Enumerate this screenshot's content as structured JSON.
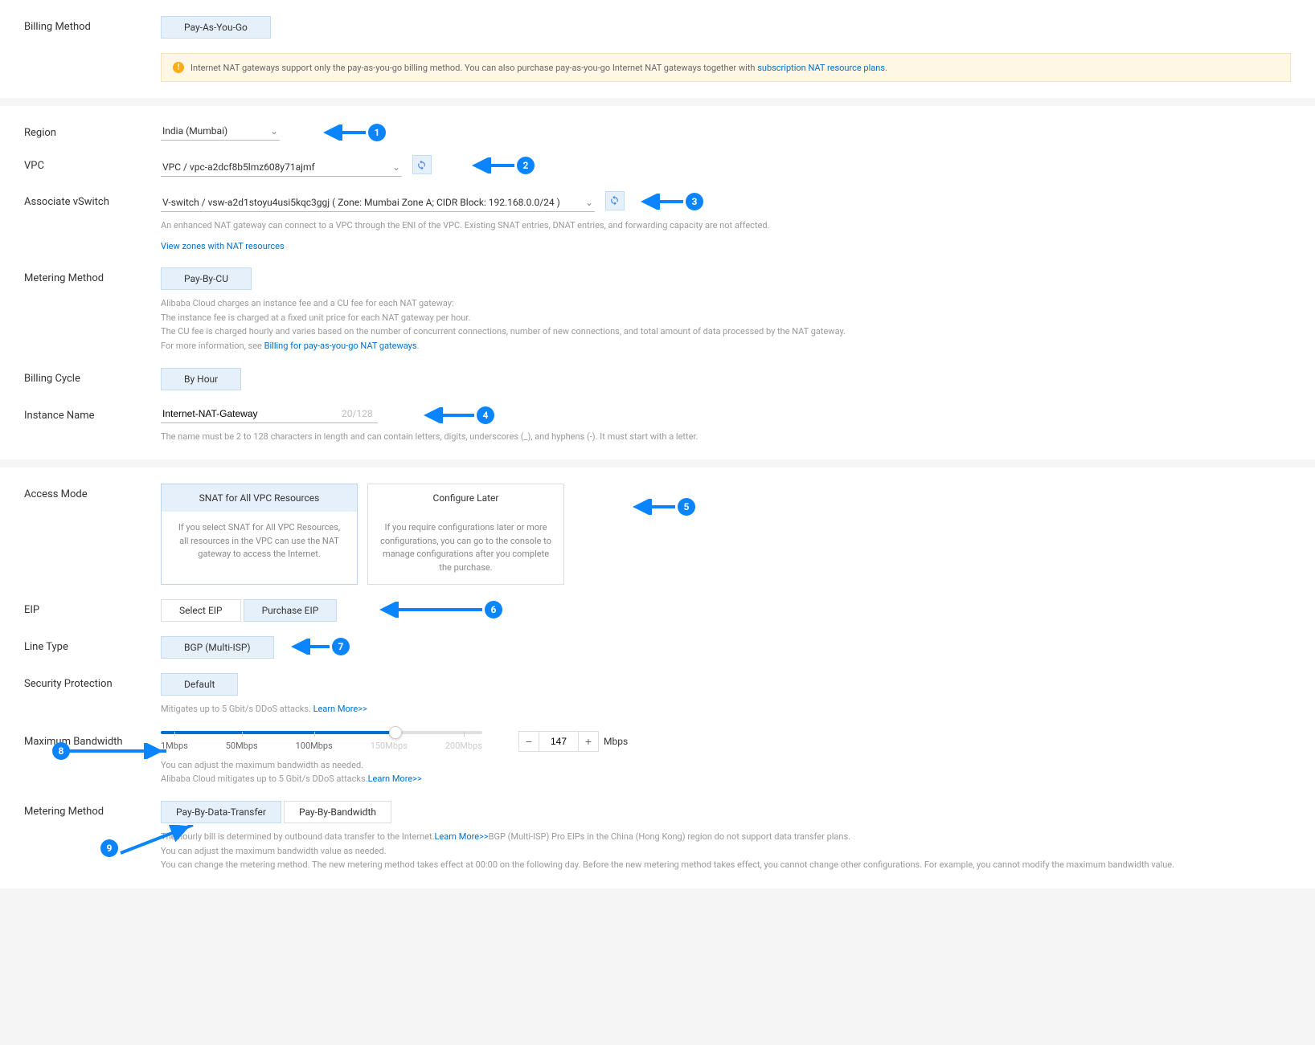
{
  "billing_method": {
    "label": "Billing Method",
    "value": "Pay-As-You-Go",
    "info_text": "Internet NAT gateways support only the pay-as-you-go billing method. You can also purchase pay-as-you-go Internet NAT gateways together with ",
    "info_link": "subscription NAT resource plans"
  },
  "region": {
    "label": "Region",
    "value": "India (Mumbai)"
  },
  "vpc": {
    "label": "VPC",
    "value": "VPC / vpc-a2dcf8b5lmz608y71ajmf"
  },
  "vswitch": {
    "label": "Associate vSwitch",
    "value": "V-switch / vsw-a2d1stoyu4usi5kqc3ggj ( Zone: Mumbai Zone A; CIDR Block: 192.168.0.0/24 )",
    "helper": "An enhanced NAT gateway can connect to a VPC through the ENI of the VPC. Existing SNAT entries, DNAT entries, and forwarding capacity are not affected.",
    "link": "View zones with NAT resources"
  },
  "metering_method": {
    "label": "Metering Method",
    "value": "Pay-By-CU",
    "h1": "Alibaba Cloud charges an instance fee and a CU fee for each NAT gateway:",
    "h2": "The instance fee is charged at a fixed unit price for each NAT gateway per hour.",
    "h3": "The CU fee is charged hourly and varies based on the number of concurrent connections, number of new connections, and total amount of data processed by the NAT gateway.",
    "h4": "For more information, see ",
    "link": "Billing for pay-as-you-go NAT gateways"
  },
  "billing_cycle": {
    "label": "Billing Cycle",
    "value": "By Hour"
  },
  "instance_name": {
    "label": "Instance Name",
    "value": "Internet-NAT-Gateway",
    "count": "20/128",
    "helper": "The name must be 2 to 128 characters in length and can contain letters, digits, underscores (_), and hyphens (-). It must start with a letter."
  },
  "access_mode": {
    "label": "Access Mode",
    "opt1_title": "SNAT for All VPC Resources",
    "opt1_desc": "If you select SNAT for All VPC Resources, all resources in the VPC can use the NAT gateway to access the Internet.",
    "opt2_title": "Configure Later",
    "opt2_desc": "If you require configurations later or more configurations, you can go to the console to manage configurations after you complete the purchase."
  },
  "eip": {
    "label": "EIP",
    "opt1": "Select EIP",
    "opt2": "Purchase EIP"
  },
  "line_type": {
    "label": "Line Type",
    "value": "BGP (Multi-ISP)"
  },
  "security": {
    "label": "Security Protection",
    "value": "Default",
    "helper": "Mitigates up to 5 Gbit/s DDoS attacks. ",
    "link": "Learn More>>"
  },
  "bandwidth": {
    "label": "Maximum Bandwidth",
    "ticks": [
      "1Mbps",
      "50Mbps",
      "100Mbps",
      "150Mbps",
      "200Mbps"
    ],
    "value": "147",
    "unit": "Mbps",
    "h1": "You can adjust the maximum bandwidth as needed.",
    "h2": "Alibaba Cloud mitigates up to 5 Gbit/s DDoS attacks.",
    "link": "Learn More>>"
  },
  "metering2": {
    "label": "Metering Method",
    "opt1": "Pay-By-Data-Transfer",
    "opt2": "Pay-By-Bandwidth",
    "h1": "The hourly bill is determined by outbound data transfer to the Internet.",
    "link": "Learn More>>",
    "h1b": "BGP (Multi-ISP) Pro EIPs in the China (Hong Kong) region do not support data transfer plans.",
    "h2": "You can adjust the maximum bandwidth value as needed.",
    "h3": "You can change the metering method. The new metering method takes effect at 00:00 on the following day. Before the new metering method takes effect, you cannot change other configurations. For example, you cannot modify the maximum bandwidth value."
  }
}
